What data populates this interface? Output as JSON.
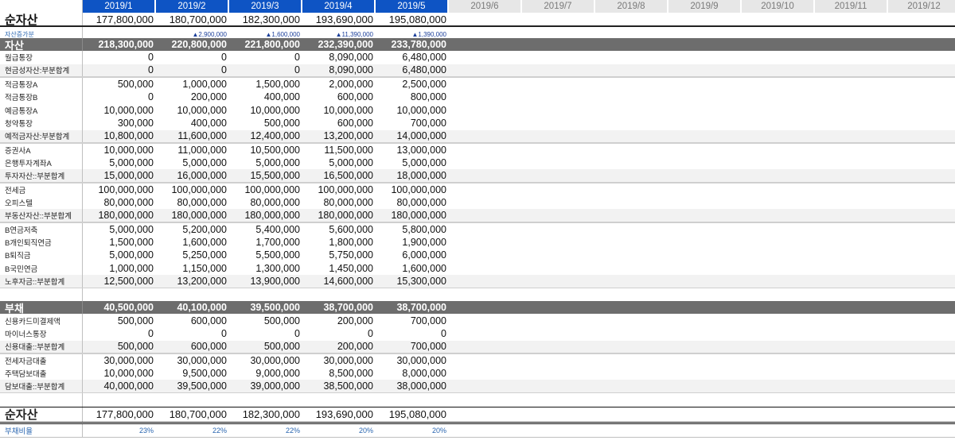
{
  "months": [
    "2019/1",
    "2019/2",
    "2019/3",
    "2019/4",
    "2019/5",
    "2019/6",
    "2019/7",
    "2019/8",
    "2019/9",
    "2019/10",
    "2019/11",
    "2019/12"
  ],
  "active_count": 5,
  "colors": {
    "header_active": "#0e54c4",
    "header_inactive": "#e7e7e7",
    "section_bg": "#6d6d6d",
    "subtotal_bg": "#f2f2f2",
    "link_blue": "#2a66b0"
  },
  "rows": [
    {
      "type": "net",
      "label": "순자산",
      "values": [
        "177,800,000",
        "180,700,000",
        "182,300,000",
        "193,690,000",
        "195,080,000"
      ]
    },
    {
      "type": "spacer",
      "label": "",
      "values": []
    },
    {
      "type": "inc",
      "label": "자산증가분",
      "values": [
        "",
        "▲2,900,000",
        "▲1,600,000",
        "▲11,390,000",
        "▲1,390,000"
      ]
    },
    {
      "type": "section",
      "label": "자산",
      "values": [
        "218,300,000",
        "220,800,000",
        "221,800,000",
        "232,390,000",
        "233,780,000"
      ]
    },
    {
      "type": "item",
      "label": "월급통장",
      "values": [
        "0",
        "0",
        "0",
        "8,090,000",
        "6,480,000"
      ]
    },
    {
      "type": "sub",
      "label": "현금성자산:부분합계",
      "values": [
        "0",
        "0",
        "0",
        "8,090,000",
        "6,480,000"
      ]
    },
    {
      "type": "item",
      "label": "적금통장A",
      "values": [
        "500,000",
        "1,000,000",
        "1,500,000",
        "2,000,000",
        "2,500,000"
      ]
    },
    {
      "type": "item",
      "label": "적금통장B",
      "values": [
        "0",
        "200,000",
        "400,000",
        "600,000",
        "800,000"
      ]
    },
    {
      "type": "item",
      "label": "예금통장A",
      "values": [
        "10,000,000",
        "10,000,000",
        "10,000,000",
        "10,000,000",
        "10,000,000"
      ]
    },
    {
      "type": "item",
      "label": "청약통장",
      "values": [
        "300,000",
        "400,000",
        "500,000",
        "600,000",
        "700,000"
      ]
    },
    {
      "type": "sub",
      "label": "예적금자산:부분합계",
      "values": [
        "10,800,000",
        "11,600,000",
        "12,400,000",
        "13,200,000",
        "14,000,000"
      ]
    },
    {
      "type": "item",
      "label": "증권사A",
      "values": [
        "10,000,000",
        "11,000,000",
        "10,500,000",
        "11,500,000",
        "13,000,000"
      ]
    },
    {
      "type": "item",
      "label": "은행투자계좌A",
      "values": [
        "5,000,000",
        "5,000,000",
        "5,000,000",
        "5,000,000",
        "5,000,000"
      ]
    },
    {
      "type": "sub",
      "label": "투자자산::부분합계",
      "values": [
        "15,000,000",
        "16,000,000",
        "15,500,000",
        "16,500,000",
        "18,000,000"
      ]
    },
    {
      "type": "item",
      "label": "전세금",
      "values": [
        "100,000,000",
        "100,000,000",
        "100,000,000",
        "100,000,000",
        "100,000,000"
      ]
    },
    {
      "type": "item",
      "label": "오피스텔",
      "values": [
        "80,000,000",
        "80,000,000",
        "80,000,000",
        "80,000,000",
        "80,000,000"
      ]
    },
    {
      "type": "sub",
      "label": "부동산자산::부분합계",
      "values": [
        "180,000,000",
        "180,000,000",
        "180,000,000",
        "180,000,000",
        "180,000,000"
      ]
    },
    {
      "type": "item",
      "label": "B연금저축",
      "values": [
        "5,000,000",
        "5,200,000",
        "5,400,000",
        "5,600,000",
        "5,800,000"
      ]
    },
    {
      "type": "item",
      "label": "B개인퇴직연금",
      "values": [
        "1,500,000",
        "1,600,000",
        "1,700,000",
        "1,800,000",
        "1,900,000"
      ]
    },
    {
      "type": "item",
      "label": "B퇴직금",
      "values": [
        "5,000,000",
        "5,250,000",
        "5,500,000",
        "5,750,000",
        "6,000,000"
      ]
    },
    {
      "type": "item",
      "label": "B국민연금",
      "values": [
        "1,000,000",
        "1,150,000",
        "1,300,000",
        "1,450,000",
        "1,600,000"
      ]
    },
    {
      "type": "sub",
      "label": "노후자금::부분합계",
      "values": [
        "12,500,000",
        "13,200,000",
        "13,900,000",
        "14,600,000",
        "15,300,000"
      ]
    },
    {
      "type": "empty",
      "label": "",
      "values": []
    },
    {
      "type": "section",
      "label": "부채",
      "values": [
        "40,500,000",
        "40,100,000",
        "39,500,000",
        "38,700,000",
        "38,700,000"
      ]
    },
    {
      "type": "item",
      "label": "신용카드미결제액",
      "values": [
        "500,000",
        "600,000",
        "500,000",
        "200,000",
        "700,000"
      ]
    },
    {
      "type": "item",
      "label": "마이너스통장",
      "values": [
        "0",
        "0",
        "0",
        "0",
        "0"
      ]
    },
    {
      "type": "sub",
      "label": "신용대출::부분합계",
      "values": [
        "500,000",
        "600,000",
        "500,000",
        "200,000",
        "700,000"
      ]
    },
    {
      "type": "item",
      "label": "전세자금대출",
      "values": [
        "30,000,000",
        "30,000,000",
        "30,000,000",
        "30,000,000",
        "30,000,000"
      ]
    },
    {
      "type": "item",
      "label": "주택담보대출",
      "values": [
        "10,000,000",
        "9,500,000",
        "9,000,000",
        "8,500,000",
        "8,000,000"
      ]
    },
    {
      "type": "sub",
      "label": "담보대출::부분합계",
      "values": [
        "40,000,000",
        "39,500,000",
        "39,000,000",
        "38,500,000",
        "38,000,000"
      ]
    },
    {
      "type": "empty",
      "label": "",
      "values": []
    },
    {
      "type": "netb",
      "label": "순자산",
      "values": [
        "177,800,000",
        "180,700,000",
        "182,300,000",
        "193,690,000",
        "195,080,000"
      ]
    },
    {
      "type": "ratio",
      "label": "부채비율",
      "values": [
        "23%",
        "22%",
        "22%",
        "20%",
        "20%"
      ]
    }
  ]
}
